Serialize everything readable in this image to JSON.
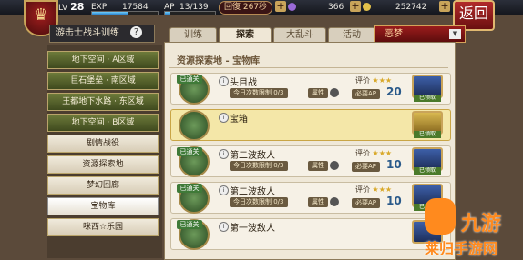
{
  "topbar": {
    "emblem": "♛",
    "lv_label": "LV",
    "lv": "28",
    "exp_label": "EXP",
    "exp_value": "17584",
    "exp_fill": 0.55,
    "ap_label": "AP",
    "ap_value": "13/139",
    "ap_fill": 0.1,
    "recovery": "回復 267秒",
    "gems": "366",
    "coins": "252742",
    "back": "返回"
  },
  "header": {
    "title": "游击士战斗训练",
    "help": "?"
  },
  "tabs": [
    {
      "label": "训练",
      "active": false
    },
    {
      "label": "探索",
      "active": true
    },
    {
      "label": "大乱斗",
      "active": false
    },
    {
      "label": "活动",
      "active": false
    }
  ],
  "difficulty": "恶梦",
  "sidebar": [
    {
      "label": "地下空间 · A区域",
      "style": "green"
    },
    {
      "label": "巨石堡垒 · 南区域",
      "style": "green"
    },
    {
      "label": "王都地下水路 · 东区域",
      "style": "green"
    },
    {
      "label": "地下空间 · B区域",
      "style": "green"
    },
    {
      "label": "剧情战役",
      "style": "plain"
    },
    {
      "label": "资源探索地",
      "style": "plain"
    },
    {
      "label": "梦幻回廊",
      "style": "plain"
    },
    {
      "label": "宝物库",
      "style": "sel"
    },
    {
      "label": "咪西☆乐园",
      "style": "plain"
    }
  ],
  "panel": {
    "title": "资源探索地 - 宝物库",
    "rows": [
      {
        "badge": "已通关",
        "name": "头目战",
        "sub": "今日次数限制 0/3",
        "attr": "属性",
        "eval": "评价",
        "stars": "★★★",
        "ap": "必要AP",
        "ap_value": "20",
        "get": "已领取",
        "highlight": false
      },
      {
        "badge": "",
        "name": "宝箱",
        "sub": "",
        "attr": "",
        "eval": "",
        "stars": "",
        "ap": "",
        "ap_value": "",
        "get": "已领取",
        "highlight": true
      },
      {
        "badge": "已通关",
        "name": "第二波敌人",
        "sub": "今日次数限制 0/3",
        "attr": "属性",
        "eval": "评价",
        "stars": "★★★",
        "ap": "必要AP",
        "ap_value": "10",
        "get": "已领取",
        "highlight": false
      },
      {
        "badge": "已通关",
        "name": "第二波敌人",
        "sub": "今日次数限制 0/3",
        "attr": "属性",
        "eval": "评价",
        "stars": "★★★",
        "ap": "必要AP",
        "ap_value": "10",
        "get": "已领取",
        "highlight": false
      },
      {
        "badge": "已通关",
        "name": "第一波敌人",
        "sub": "",
        "attr": "",
        "eval": "",
        "stars": "",
        "ap": "",
        "ap_value": "",
        "get": "",
        "highlight": false
      }
    ]
  },
  "watermark": {
    "logo": "九游",
    "text": "莱归手游网"
  }
}
